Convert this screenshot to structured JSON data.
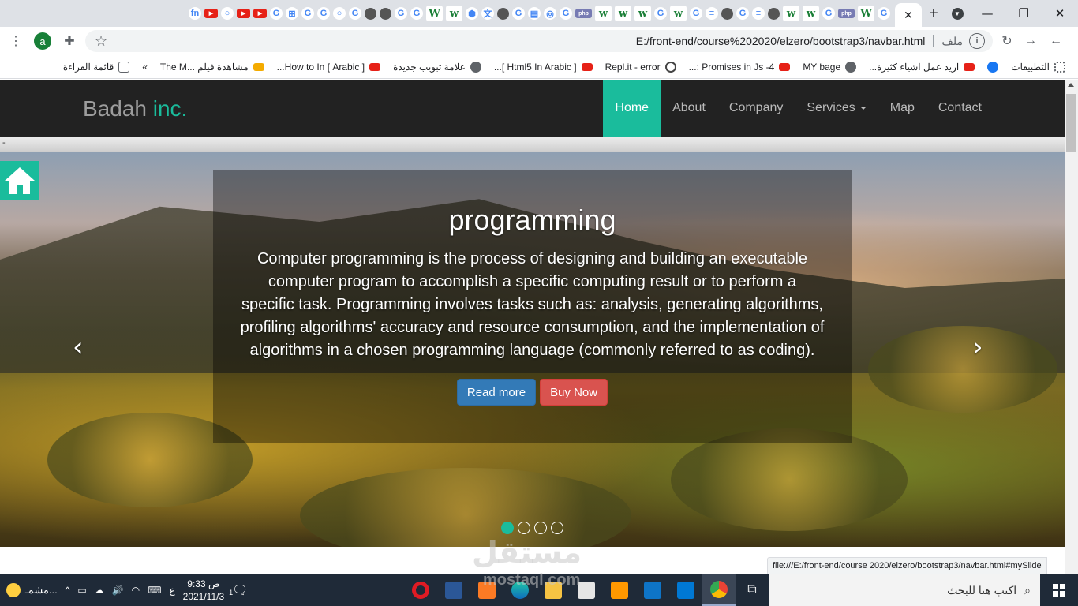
{
  "browser": {
    "window_controls": {
      "close": "✕",
      "maximize": "❐",
      "minimize": "—"
    },
    "active_tab_close": "✕",
    "new_tab": "+",
    "address": {
      "scheme_label": "ملف",
      "url": "E:/front-end/course%202020/elzero/bootstrap3/navbar.html"
    },
    "profile_initial": "a",
    "bookmarks": [
      {
        "label": "التطبيقات",
        "icon": "apps-grid-icon"
      },
      {
        "label": "",
        "icon": "facebook-icon"
      },
      {
        "label": "اريد عمل اشياء كثيرة...",
        "icon": "youtube-icon"
      },
      {
        "label": "MY bage",
        "icon": "globe-icon"
      },
      {
        "label": "4- Promises in Js :...",
        "icon": "youtube-icon"
      },
      {
        "label": "Repl.it - error",
        "icon": "replit-icon"
      },
      {
        "label": "[ Html5 In Arabic ]...",
        "icon": "youtube-icon"
      },
      {
        "label": "علامة تبويب جديدة",
        "icon": "globe-icon"
      },
      {
        "label": "[ Arabic ] How to In...",
        "icon": "youtube-icon"
      },
      {
        "label": "مشاهدة فيلم ...The M",
        "icon": "film-site-icon"
      }
    ],
    "bookmarks_overflow": "»",
    "reading_list": "قائمة القراءة",
    "status_link": "file:///E:/front-end/course 2020/elzero/bootstrap3/navbar.html#mySlide"
  },
  "site": {
    "brand": {
      "name": "Badah",
      "accent": "inc."
    },
    "nav": [
      {
        "label": "Home",
        "active": true
      },
      {
        "label": "About",
        "active": false
      },
      {
        "label": "Company",
        "active": false
      },
      {
        "label": "Services",
        "active": false,
        "dropdown": true
      },
      {
        "label": "Map",
        "active": false
      },
      {
        "label": "Contact",
        "active": false
      }
    ],
    "strip_text": "-",
    "slide": {
      "title": "programming",
      "text": "Computer programming is the process of designing and building an executable computer program to accomplish a specific computing result or to perform a specific task. Programming involves tasks such as: analysis, generating algorithms, profiling algorithms' accuracy and resource consumption, and the implementation of algorithms in a chosen programming language (commonly referred to as coding).",
      "read_more": "Read more",
      "buy_now": "Buy Now",
      "prev": "‹",
      "next": "›",
      "indicators": 4,
      "active_indicator": 0
    },
    "accent_color": "#1abc9c"
  },
  "watermark": {
    "text": "مستقل",
    "sub": "mostaql.com"
  },
  "taskbar": {
    "search_placeholder": "اكتب هنا للبحث",
    "weather": "مشمـ...",
    "time": "9:33 ص",
    "date": "2021/11/3",
    "lang": "ع",
    "notification_count": "1"
  }
}
